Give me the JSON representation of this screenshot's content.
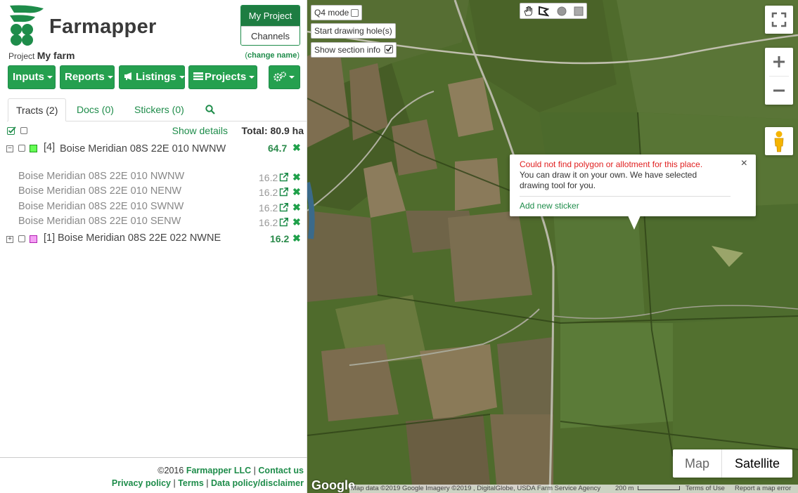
{
  "brand": {
    "name": "Farmapper",
    "color": "#1e8c4a"
  },
  "project_switch": {
    "active": "My Project",
    "other": "Channels"
  },
  "project": {
    "prefix": "Project",
    "name": "My farm",
    "change_label": "change name"
  },
  "toolbar": [
    {
      "label": "Inputs"
    },
    {
      "label": "Reports"
    },
    {
      "label": "Listings",
      "icon": "megaphone-icon"
    },
    {
      "label": "Projects",
      "icon": "table-icon"
    },
    {
      "label": "",
      "icon": "gears-icon"
    }
  ],
  "tabs": [
    {
      "label": "Tracts (2)",
      "active": true
    },
    {
      "label": "Docs  (0)"
    },
    {
      "label": "Stickers  (0)"
    },
    {
      "label": "",
      "icon": "search-icon"
    }
  ],
  "list": {
    "show_details": "Show details",
    "total_label": "Total:",
    "total_value": "80.9 ha",
    "tracts": [
      {
        "prefix": "[4]",
        "name": "Boise Meridian 08S 22E 010 NWNW",
        "value": "64.7",
        "expanded": true,
        "color": "#22cc22",
        "subtracts": [
          {
            "name": "Boise Meridian 08S 22E 010 NWNW",
            "value": "16.2"
          },
          {
            "name": "Boise Meridian 08S 22E 010 NENW",
            "value": "16.2"
          },
          {
            "name": "Boise Meridian 08S 22E 010 SWNW",
            "value": "16.2"
          },
          {
            "name": "Boise Meridian 08S 22E 010 SENW",
            "value": "16.2"
          }
        ]
      },
      {
        "prefix": "[1]",
        "name": "Boise Meridian 08S 22E 022 NWNE",
        "value": "16.2",
        "expanded": false,
        "color": "#e040e0"
      }
    ]
  },
  "footer": {
    "copyright": "©2016",
    "company": "Farmapper LLC",
    "contact": "Contact us",
    "privacy": "Privacy policy",
    "terms": "Terms",
    "data_policy": "Data policy/disclaimer"
  },
  "map": {
    "q4_mode": "Q4 mode",
    "start_holes": "Start drawing hole(s)",
    "show_section_info": "Show section info",
    "show_section_checked": true,
    "popup": {
      "error": "Could not find polygon or allotment for this place.",
      "message": "You can draw it on your own. We have selected drawing tool for you.",
      "link": "Add new sticker"
    },
    "map_type": {
      "map": "Map",
      "satellite": "Satellite"
    },
    "google": "Google",
    "attribution": "Map data ©2019 Google Imagery ©2019 , DigitalGlobe, USDA Farm Service Agency",
    "scale": "200 m",
    "terms": "Terms of Use",
    "report": "Report a map error"
  }
}
